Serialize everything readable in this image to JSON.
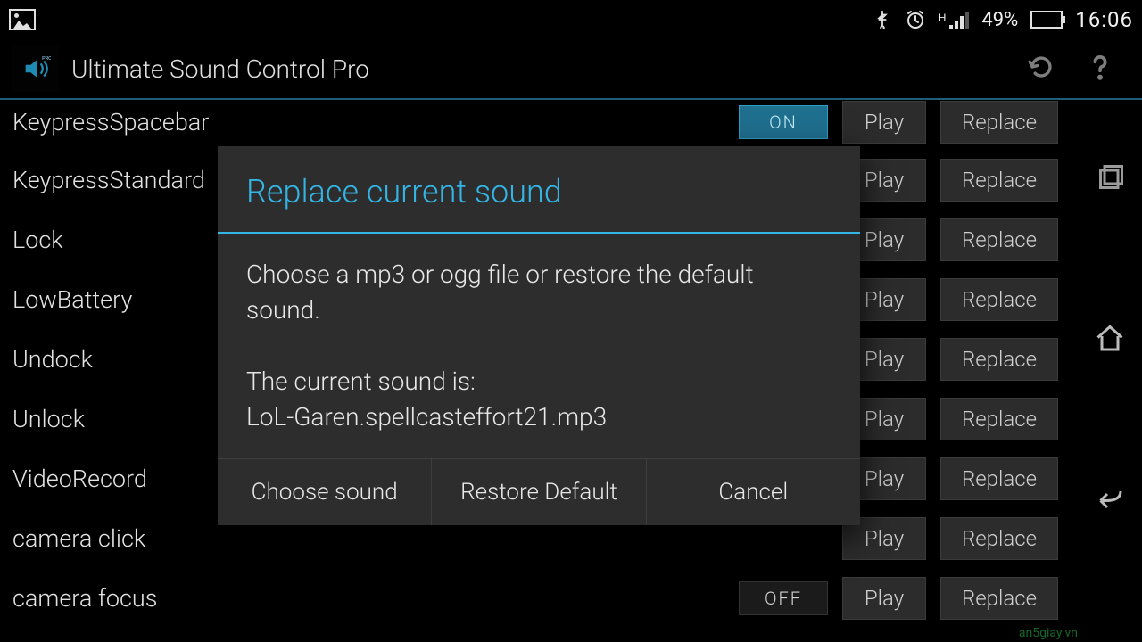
{
  "statusbar": {
    "signal_type": "H",
    "battery_pct": "49%",
    "clock": "16:06"
  },
  "actionbar": {
    "title": "Ultimate Sound Control Pro"
  },
  "list": {
    "play_label": "Play",
    "replace_label": "Replace",
    "toggle_on": "ON",
    "toggle_off": "OFF",
    "rows": [
      {
        "name": "KeypressSpacebar",
        "state": "on"
      },
      {
        "name": "KeypressStandard",
        "state": null
      },
      {
        "name": "Lock",
        "state": null
      },
      {
        "name": "LowBattery",
        "state": null
      },
      {
        "name": "Undock",
        "state": null
      },
      {
        "name": "Unlock",
        "state": null
      },
      {
        "name": "VideoRecord",
        "state": null
      },
      {
        "name": "camera click",
        "state": null
      },
      {
        "name": "camera focus",
        "state": "off"
      }
    ]
  },
  "dialog": {
    "title": "Replace current sound",
    "body_line1": "Choose a mp3 or ogg file or restore the default sound.",
    "body_line2": "The current sound is:",
    "body_line3": "LoL-Garen.spellcasteffort21.mp3",
    "choose": "Choose sound",
    "restore": "Restore Default",
    "cancel": "Cancel"
  },
  "watermark": "an5giay.vn",
  "battery_fill_pct": 49
}
